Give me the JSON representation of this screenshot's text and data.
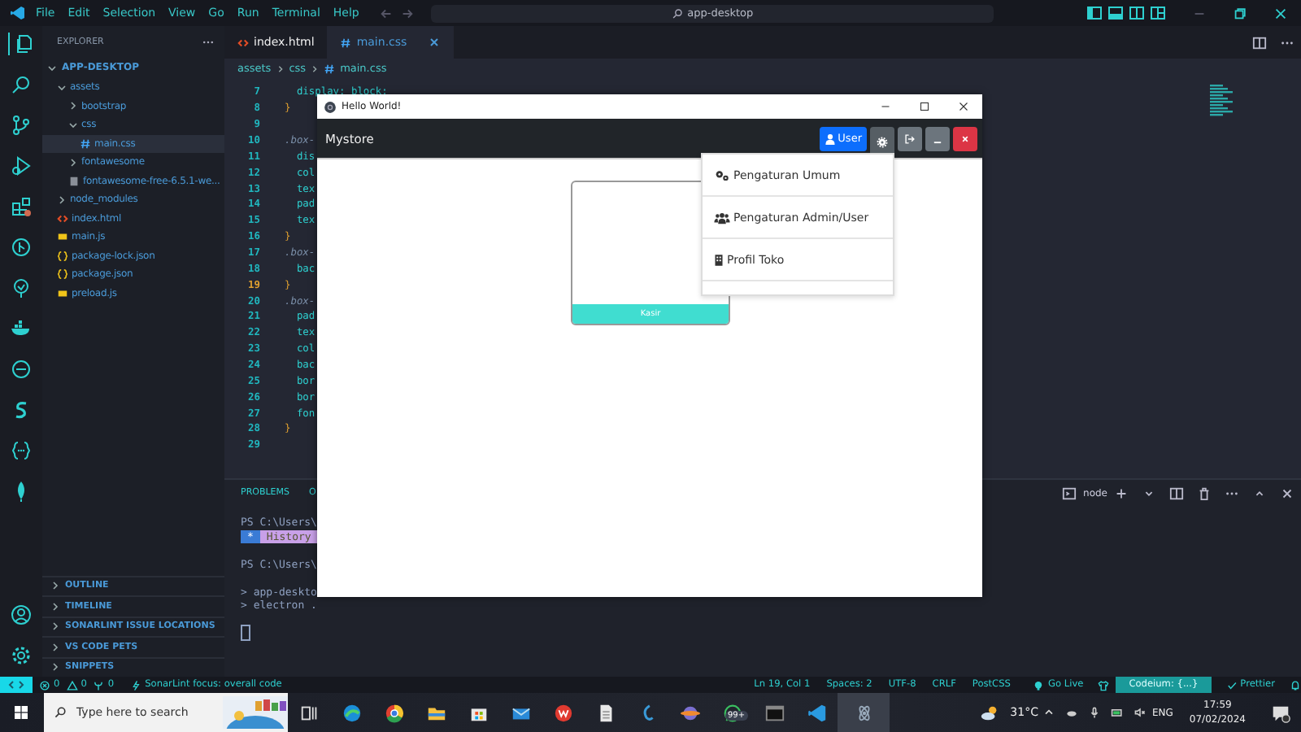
{
  "titlebar": {
    "menus": [
      "File",
      "Edit",
      "Selection",
      "View",
      "Go",
      "Run",
      "Terminal",
      "Help"
    ],
    "search": "app-desktop"
  },
  "sidebar": {
    "title": "EXPLORER",
    "root": "APP-DESKTOP",
    "tree": [
      {
        "label": "assets",
        "kind": "folder",
        "expanded": true,
        "selected": false,
        "children": [
          {
            "label": "bootstrap",
            "kind": "folder",
            "expanded": false,
            "selected": false
          },
          {
            "label": "css",
            "kind": "folder",
            "expanded": true,
            "selected": false,
            "children": [
              {
                "label": "main.css",
                "kind": "css",
                "selected": true
              }
            ]
          },
          {
            "label": "fontawesome",
            "kind": "folder",
            "expanded": false,
            "selected": false
          },
          {
            "label": "fontawesome-free-6.5.1-we...",
            "kind": "zip",
            "selected": false
          }
        ]
      },
      {
        "label": "node_modules",
        "kind": "folder",
        "expanded": false,
        "selected": false
      },
      {
        "label": "index.html",
        "kind": "html",
        "selected": false
      },
      {
        "label": "main.js",
        "kind": "js",
        "selected": false
      },
      {
        "label": "package-lock.json",
        "kind": "json",
        "selected": false
      },
      {
        "label": "package.json",
        "kind": "json",
        "selected": false
      },
      {
        "label": "preload.js",
        "kind": "js",
        "selected": false
      }
    ],
    "sections": [
      "OUTLINE",
      "TIMELINE",
      "SONARLINT ISSUE LOCATIONS",
      "VS CODE PETS",
      "SNIPPETS"
    ]
  },
  "editor": {
    "tabs": [
      {
        "label": "index.html",
        "kind": "html",
        "selected": false
      },
      {
        "label": "main.css",
        "kind": "css",
        "selected": true
      }
    ],
    "breadcrumb": [
      "assets",
      "css",
      "main.css"
    ],
    "lines": [
      {
        "n": "7",
        "text": "  display: block;",
        "kind": "prop"
      },
      {
        "n": "8",
        "text": "}",
        "kind": "brace"
      },
      {
        "n": "9"
      },
      {
        "n": "10",
        "text": ".box-",
        "kind": "selector"
      },
      {
        "n": "11",
        "text": "  dis",
        "kind": "prop"
      },
      {
        "n": "12",
        "text": "  col",
        "kind": "prop"
      },
      {
        "n": "13",
        "text": "  tex",
        "kind": "prop"
      },
      {
        "n": "14",
        "text": "  pad",
        "kind": "prop"
      },
      {
        "n": "15",
        "text": "  tex",
        "kind": "prop"
      },
      {
        "n": "16",
        "text": "}",
        "kind": "brace"
      },
      {
        "n": "17",
        "text": ".box-",
        "kind": "selector"
      },
      {
        "n": "18",
        "text": "  bac",
        "kind": "prop"
      },
      {
        "n": "19",
        "text": "}",
        "kind": "brace",
        "current": true
      },
      {
        "n": "20",
        "text": ".box-",
        "kind": "selector"
      },
      {
        "n": "21",
        "text": "  pad",
        "kind": "prop"
      },
      {
        "n": "22",
        "text": "  tex",
        "kind": "prop"
      },
      {
        "n": "23",
        "text": "  col",
        "kind": "prop"
      },
      {
        "n": "24",
        "text": "  bac",
        "kind": "prop"
      },
      {
        "n": "25",
        "text": "  bor",
        "kind": "prop"
      },
      {
        "n": "26",
        "text": "  bor",
        "kind": "prop"
      },
      {
        "n": "27",
        "text": "  fon",
        "kind": "prop"
      },
      {
        "n": "28",
        "text": "}",
        "kind": "brace"
      },
      {
        "n": "29"
      }
    ]
  },
  "panel": {
    "tabs": [
      "PROBLEMS",
      "O"
    ],
    "shell": "node",
    "terminal": [
      {
        "kind": "prompt",
        "text": "PS C:\\Users\\"
      },
      {
        "kind": "history",
        "marker": "*",
        "text": "History"
      },
      {
        "kind": "blank"
      },
      {
        "kind": "prompt",
        "text": "PS C:\\Users\\"
      },
      {
        "kind": "blank"
      },
      {
        "kind": "output",
        "text": "> app-deskto"
      },
      {
        "kind": "output",
        "text": "> electron ."
      }
    ]
  },
  "app_window": {
    "title": "Hello World!",
    "brand": "Mystore",
    "user_button": "User",
    "menu": [
      {
        "label": "Pengaturan Umum",
        "kind": "gears"
      },
      {
        "label": "Pengaturan Admin/User",
        "kind": "users"
      },
      {
        "label": "Profil Toko",
        "kind": "building"
      }
    ],
    "card": {
      "label": "Kasir"
    }
  },
  "status_bar": {
    "errors": "0",
    "warnings": "0",
    "ports": "0",
    "sonarlint": "SonarLint focus: overall code",
    "items": [
      "Ln 19, Col 1",
      "Spaces: 2",
      "UTF-8",
      "CRLF",
      "PostCSS"
    ],
    "golive": "Go Live",
    "codeium": "Codeium: {...}",
    "prettier": "Prettier"
  },
  "taskbar": {
    "search_placeholder": "Type here to search",
    "badge": "99+",
    "weather": "31°C",
    "lang": "ENG",
    "time": "17:59",
    "date": "07/02/2024"
  }
}
